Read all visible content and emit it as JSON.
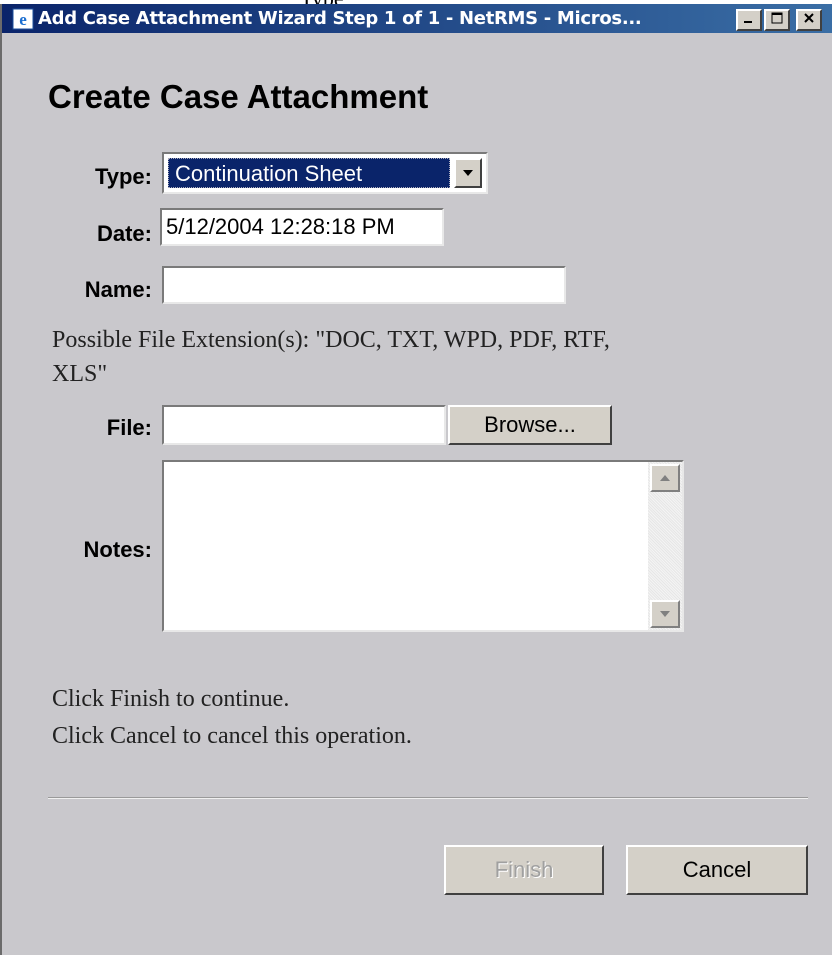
{
  "window": {
    "title": "Add Case Attachment Wizard Step 1 of 1 - NetRMS - Micros..."
  },
  "heading": "Create Case Attachment",
  "form": {
    "type_label": "Type:",
    "type_value": "Continuation Sheet",
    "date_label": "Date:",
    "date_value": "5/12/2004 12:28:18 PM",
    "name_label": "Name:",
    "name_value": "",
    "extensions_line1": "Possible File Extension(s):  \"DOC, TXT, WPD, PDF, RTF,",
    "extensions_line2": "XLS\"",
    "file_label": "File:",
    "file_value": "",
    "browse_label": "Browse...",
    "notes_label": "Notes:",
    "notes_value": ""
  },
  "instructions": {
    "line1": "Click Finish to continue.",
    "line2": "Click Cancel to cancel this operation."
  },
  "buttons": {
    "finish": "Finish",
    "cancel": "Cancel"
  },
  "icons": {
    "app": "ie-icon",
    "minimize": "minimize-icon",
    "maximize": "maximize-icon",
    "close": "close-icon"
  },
  "colors": {
    "titlebar": "#0a246a",
    "window_bg": "#c9c8cc",
    "selection": "#0a246a"
  }
}
